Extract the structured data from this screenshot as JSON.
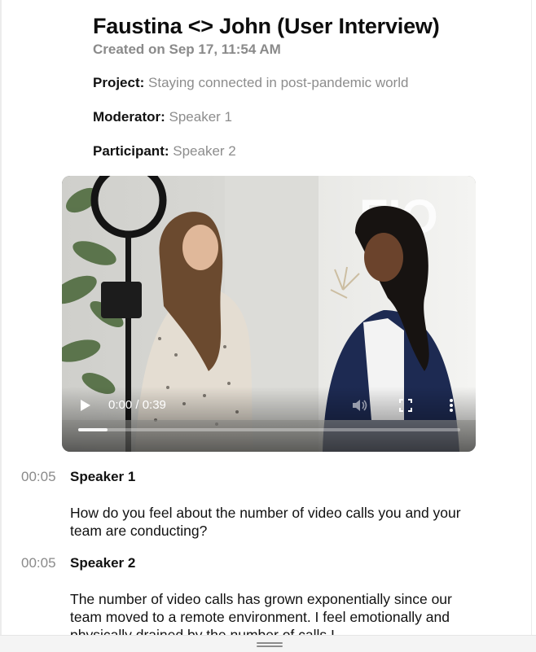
{
  "header": {
    "title": "Faustina <> John (User Interview)",
    "created": "Created on Sep 17, 11:54 AM"
  },
  "meta": {
    "project_label": "Project:",
    "project_value": "Staying connected in post-pandemic world",
    "moderator_label": "Moderator:",
    "moderator_value": "Speaker 1",
    "participant_label": "Participant:",
    "participant_value": "Speaker 2"
  },
  "video": {
    "time": "0:00 / 0:39",
    "progress": 0.077,
    "icons": [
      "play-icon",
      "volume-icon",
      "fullscreen-icon",
      "more-options-icon"
    ]
  },
  "transcript": [
    {
      "timestamp": "00:05",
      "speaker": "Speaker 1",
      "text": "How do you feel about the number of video calls you and your team are conducting?"
    },
    {
      "timestamp": "00:05",
      "speaker": "Speaker 2",
      "text": "The number of video calls has grown exponentially since our team moved to a remote environment. I feel emotionally and physically drained by the number of calls I"
    }
  ],
  "colors": {
    "muted_text": "#8a8a8a",
    "body_text": "#111111",
    "video_bg": "#2b2b2b"
  }
}
